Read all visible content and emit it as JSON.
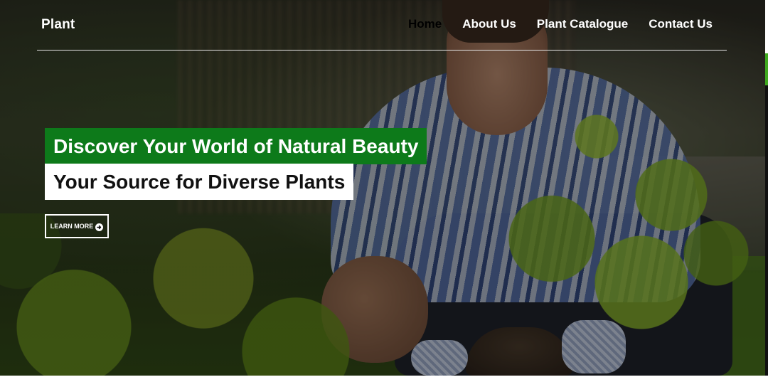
{
  "nav": {
    "logo": "Plant",
    "links": [
      {
        "label": "Home",
        "active": true
      },
      {
        "label": "About Us",
        "active": false
      },
      {
        "label": "Plant Catalogue",
        "active": false
      },
      {
        "label": "Contact Us",
        "active": false
      }
    ]
  },
  "hero": {
    "headline_primary": "Discover Your World of Natural Beauty",
    "headline_secondary": "Your Source for Diverse Plants",
    "cta_label": "LEARN MORE",
    "cta_icon": "arrow-right-circle-icon",
    "image": "gardener-planting-shrub-photo"
  },
  "colors": {
    "accent_green": "#0d7a1a",
    "scroll_accent": "#3fa91f",
    "text_white": "#ffffff",
    "active_link": "#000000"
  }
}
